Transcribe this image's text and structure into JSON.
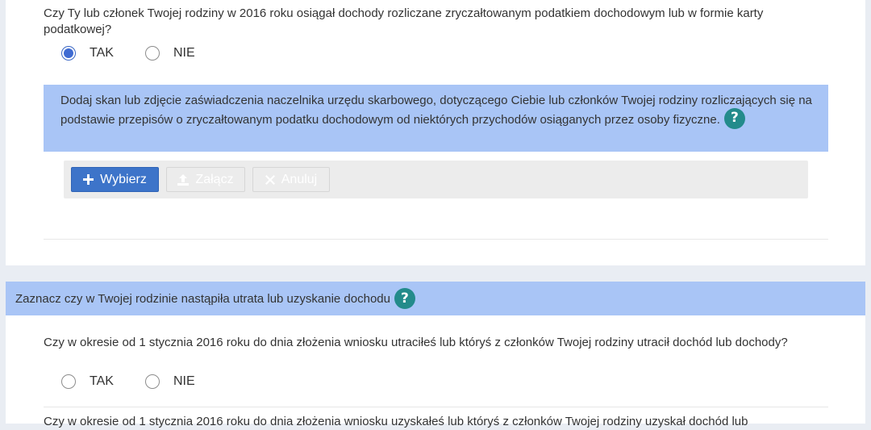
{
  "section1": {
    "question": "Czy Ty lub członek Twojej rodziny w 2016 roku osiągał dochody rozliczane zryczałtowanym podatkiem dochodowym lub w formie karty podatkowej?",
    "options": [
      {
        "label": "TAK",
        "checked": true
      },
      {
        "label": "NIE",
        "checked": false
      }
    ],
    "info_text": "Dodaj skan lub zdjęcie zaświadczenia naczelnika urzędu skarbowego, dotyczącego Ciebie lub członków Twojej rodziny rozliczających się na podstawie przepisów o zryczałtowanym podatku dochodowym od niektórych przychodów osiąganych przez osoby fizyczne.",
    "help_icon": "?",
    "upload": {
      "choose_label": "Wybierz",
      "attach_label": "Załącz",
      "cancel_label": "Anuluj"
    }
  },
  "section2": {
    "header": "Zaznacz czy w Twojej rodzinie nastąpiła utrata lub uzyskanie dochodu",
    "help_icon": "?",
    "question_lost": "Czy w okresie od 1 stycznia 2016 roku do dnia złożenia wniosku utraciłeś lub któryś z członków Twojej rodziny utracił dochód lub dochody?",
    "options": [
      {
        "label": "TAK",
        "checked": false
      },
      {
        "label": "NIE",
        "checked": false
      }
    ],
    "question_gained": "Czy w okresie od 1 stycznia 2016 roku do dnia złożenia wniosku uzyskałeś lub któryś z członków Twojej rodziny uzyskał dochód lub"
  },
  "colors": {
    "info_bg": "#a9c5f6",
    "primary_button": "#3d74c9",
    "help_icon": "#238b8b",
    "radio_checked": "#3f6bd2"
  }
}
